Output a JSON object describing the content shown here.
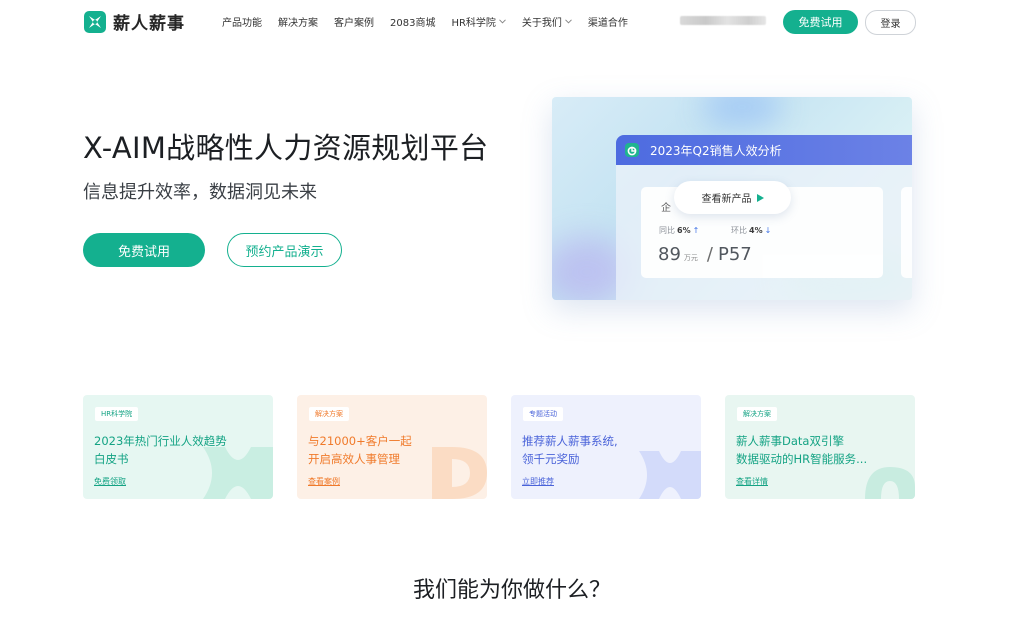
{
  "header": {
    "brand": "薪人薪事",
    "nav": [
      {
        "label": "产品功能",
        "dropdown": false
      },
      {
        "label": "解决方案",
        "dropdown": false
      },
      {
        "label": "客户案例",
        "dropdown": false
      },
      {
        "label": "2083商城",
        "dropdown": false
      },
      {
        "label": "HR科学院",
        "dropdown": true
      },
      {
        "label": "关于我们",
        "dropdown": true
      },
      {
        "label": "渠道合作",
        "dropdown": false
      }
    ],
    "trial_label": "免费试用",
    "login_label": "登录"
  },
  "hero": {
    "title": "X-AIM战略性人力资源规划平台",
    "subtitle": "信息提升效率，数据洞见未来",
    "primary_button": "免费试用",
    "secondary_button": "预约产品演示"
  },
  "dashboard": {
    "title": "2023年Q2销售人效分析",
    "card_label": "企",
    "yoy_label": "同比",
    "yoy_value": "6%",
    "mom_label": "环比",
    "mom_value": "4%",
    "value_main": "89",
    "value_unit": "万元",
    "value_separator": "/",
    "value_level": "P57",
    "play_button": "查看新产品"
  },
  "promos": [
    {
      "tag": "HR科学院",
      "title": "2023年热门行业人效趋势\n白皮书",
      "link": "免费领取"
    },
    {
      "tag": "解决方案",
      "title": "与21000+客户一起\n开启高效人事管理",
      "link": "查看案例"
    },
    {
      "tag": "专题活动",
      "title": "推荐薪人薪事系统,\n领千元奖励",
      "link": "立即推荐"
    },
    {
      "tag": "解决方案",
      "title": "薪人薪事Data双引擎\n数据驱动的HR智能服务...",
      "link": "查看详情"
    }
  ],
  "section": {
    "title": "我们能为你做什么？"
  },
  "colors": {
    "brand_green": "#14b08f",
    "dashboard_blue": "#4d6be0",
    "orange": "#f07a2b",
    "indigo": "#4a63d9"
  }
}
